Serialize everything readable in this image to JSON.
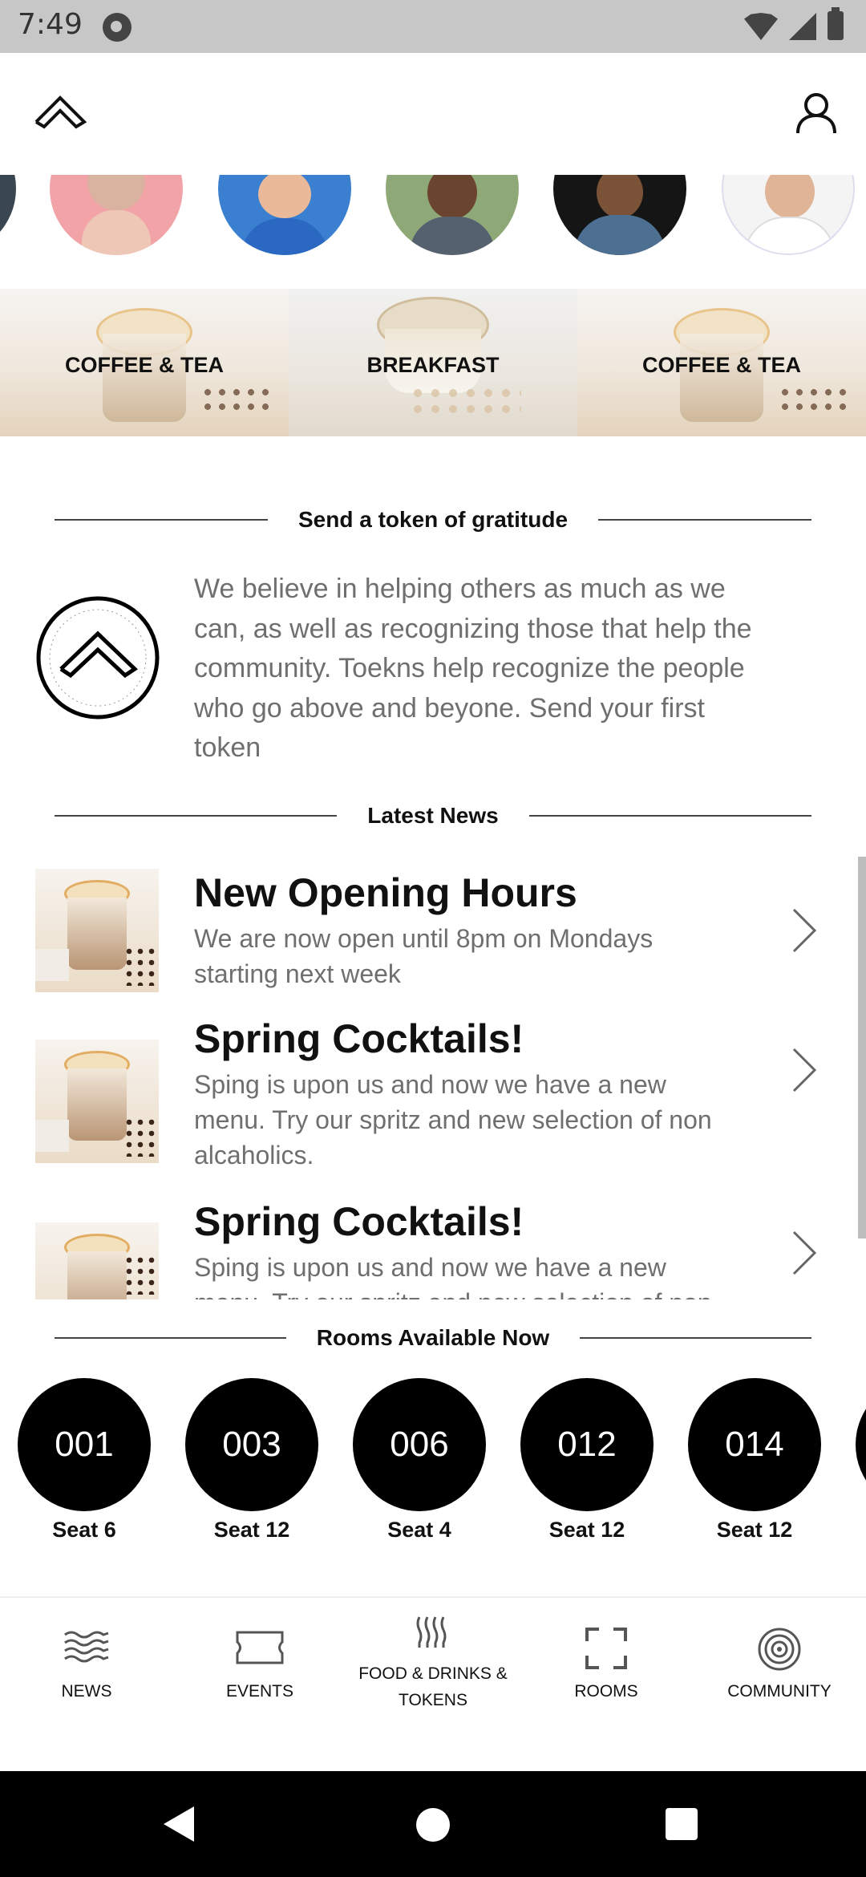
{
  "status_bar": {
    "time": "7:49",
    "icons": [
      "sync-icon",
      "wifi-icon",
      "signal-icon",
      "battery-icon"
    ]
  },
  "header": {
    "logo_icon": "chevron-up-logo",
    "profile_icon": "user-icon"
  },
  "avatars": [
    "person-1",
    "person-2",
    "person-3",
    "person-4",
    "person-5",
    "person-6"
  ],
  "categories": [
    {
      "label": "COFFEE & TEA"
    },
    {
      "label": "BREAKFAST"
    },
    {
      "label": "COFFEE & TEA"
    }
  ],
  "gratitude": {
    "title": "Send a token of gratitude",
    "text": "We believe in helping others as much as we can, as well as recognizing those that help the community. Toekns help recognize the people who go above and beyone. Send your first token"
  },
  "news": {
    "title": "Latest News",
    "items": [
      {
        "title": "New Opening Hours",
        "body": "We are now open until 8pm on Mondays starting next week"
      },
      {
        "title": "Spring Cocktails!",
        "body": "Sping is upon us and now we have a new menu. Try our spritz and new selection of non alcaholics."
      },
      {
        "title": "Spring Cocktails!",
        "body": "Sping is upon us and now we have a new menu. Try our spritz and new selection of non alcaholics."
      }
    ]
  },
  "rooms": {
    "title": "Rooms Available Now",
    "items": [
      {
        "number": "001",
        "seat": "Seat 6"
      },
      {
        "number": "003",
        "seat": "Seat 12"
      },
      {
        "number": "006",
        "seat": "Seat 4"
      },
      {
        "number": "012",
        "seat": "Seat 12"
      },
      {
        "number": "014",
        "seat": "Seat 12"
      },
      {
        "number": "",
        "seat": ""
      }
    ]
  },
  "bottom_nav": [
    {
      "label": "NEWS",
      "icon": "waves-icon"
    },
    {
      "label": "EVENTS",
      "icon": "ticket-icon"
    },
    {
      "label": "FOOD & DRINKS & TOKENS",
      "icon": "steam-icon"
    },
    {
      "label": "ROOMS",
      "icon": "frame-icon"
    },
    {
      "label": "COMMUNITY",
      "icon": "target-icon"
    }
  ],
  "colors": {
    "text_dark": "#111111",
    "text_grey": "#6f6f6f",
    "status_bar": "#c7c7c7",
    "room_circle": "#000000"
  }
}
